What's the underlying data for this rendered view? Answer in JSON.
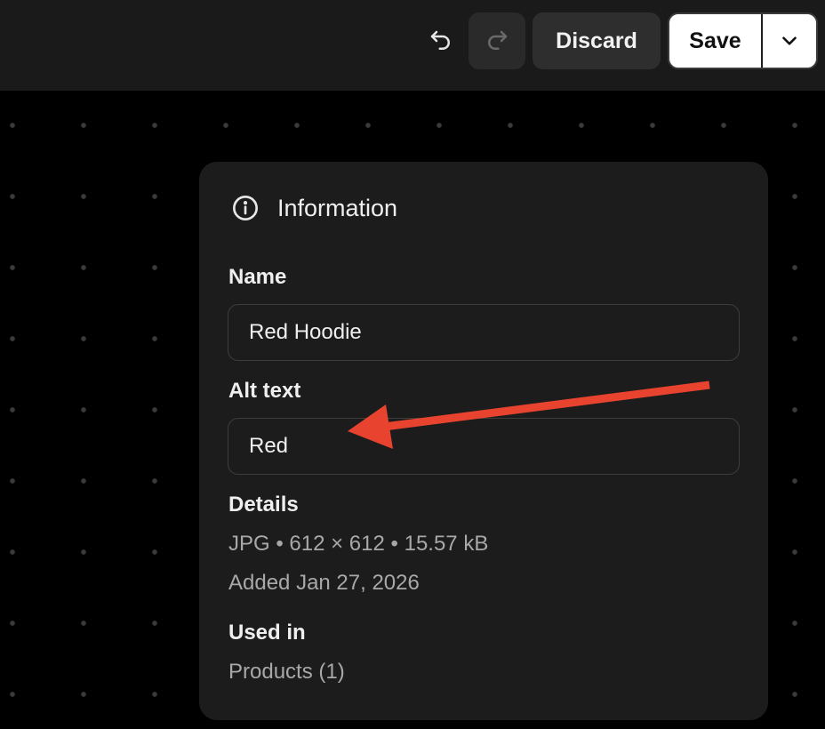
{
  "toolbar": {
    "undo_icon": "undo-icon",
    "redo_icon": "redo-icon",
    "discard_label": "Discard",
    "save_label": "Save",
    "save_menu_icon": "chevron-down-icon"
  },
  "panel": {
    "icon": "info-icon",
    "title": "Information",
    "name_label": "Name",
    "name_value": "Red Hoodie",
    "alt_label": "Alt text",
    "alt_value": "Red",
    "details_label": "Details",
    "details_line": "JPG • 612 × 612 • 15.57 kB",
    "added_line": "Added Jan 27, 2026",
    "used_in_label": "Used in",
    "used_in_value": "Products (1)"
  },
  "annotation": {
    "arrow_color": "#e8432f"
  },
  "colors": {
    "topbar_bg": "#1a1a1a",
    "panel_bg": "#1c1c1c",
    "save_bg": "#ffffff"
  }
}
